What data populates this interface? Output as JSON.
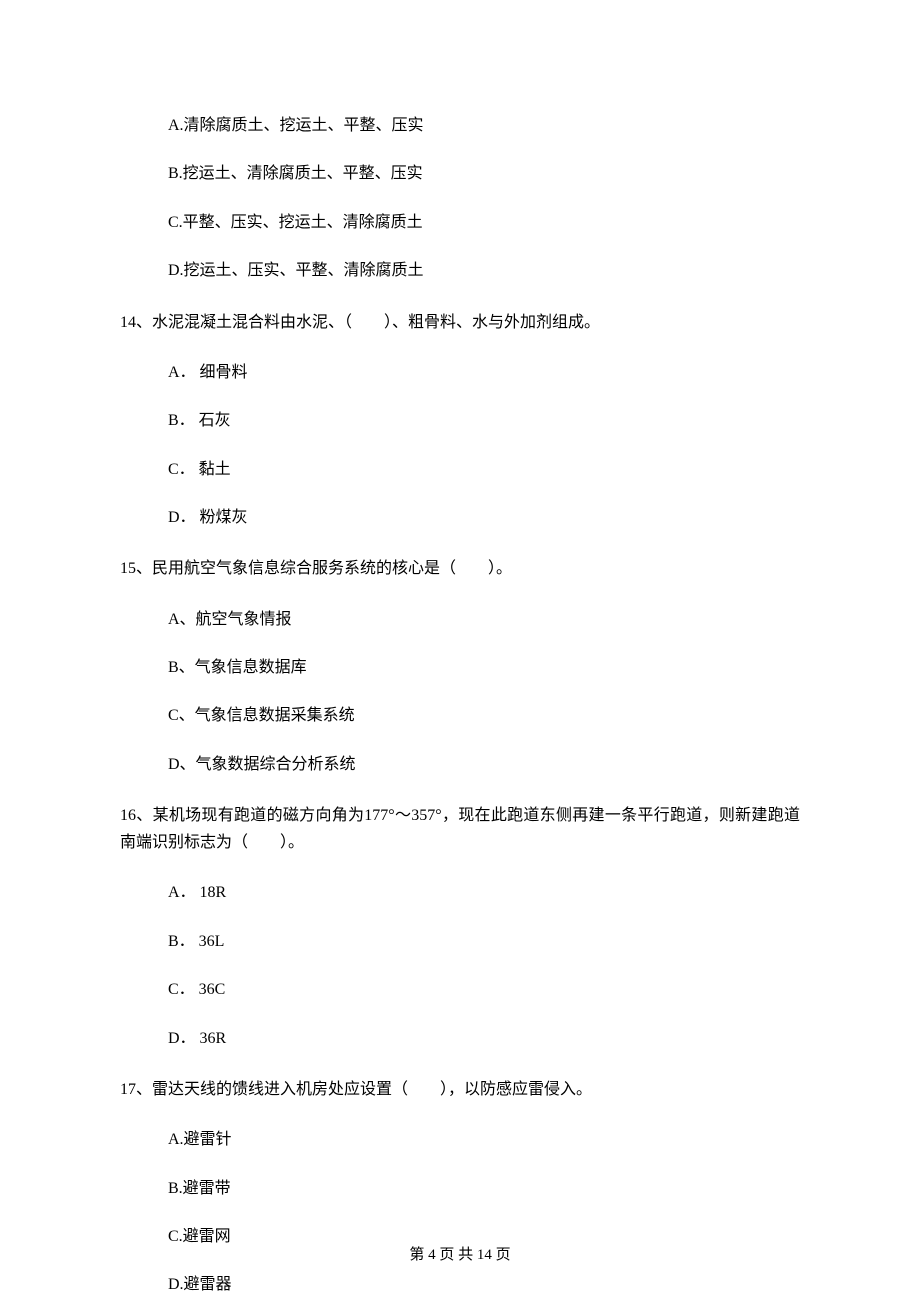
{
  "q13_options": {
    "a": "A.清除腐质土、挖运土、平整、压实",
    "b": "B.挖运土、清除腐质土、平整、压实",
    "c": "C.平整、压实、挖运土、清除腐质土",
    "d": "D.挖运土、压实、平整、清除腐质土"
  },
  "q14": {
    "text": "14、水泥混凝土混合料由水泥、（　　）、粗骨料、水与外加剂组成。",
    "a": "A． 细骨料",
    "b": "B． 石灰",
    "c": "C． 黏土",
    "d": "D． 粉煤灰"
  },
  "q15": {
    "text": "15、民用航空气象信息综合服务系统的核心是（　　）。",
    "a": "A、航空气象情报",
    "b": "B、气象信息数据库",
    "c": "C、气象信息数据采集系统",
    "d": "D、气象数据综合分析系统"
  },
  "q16": {
    "text": "16、某机场现有跑道的磁方向角为177°～357°，现在此跑道东侧再建一条平行跑道，则新建跑道南端识别标志为（　　）。",
    "a": "A． 18R",
    "b": "B． 36L",
    "c": "C． 36C",
    "d": "D． 36R"
  },
  "q17": {
    "text": "17、雷达天线的馈线进入机房处应设置（　　），以防感应雷侵入。",
    "a": "A.避雷针",
    "b": "B.避雷带",
    "c": "C.避雷网",
    "d": "D.避雷器"
  },
  "footer": "第 4 页 共 14 页"
}
